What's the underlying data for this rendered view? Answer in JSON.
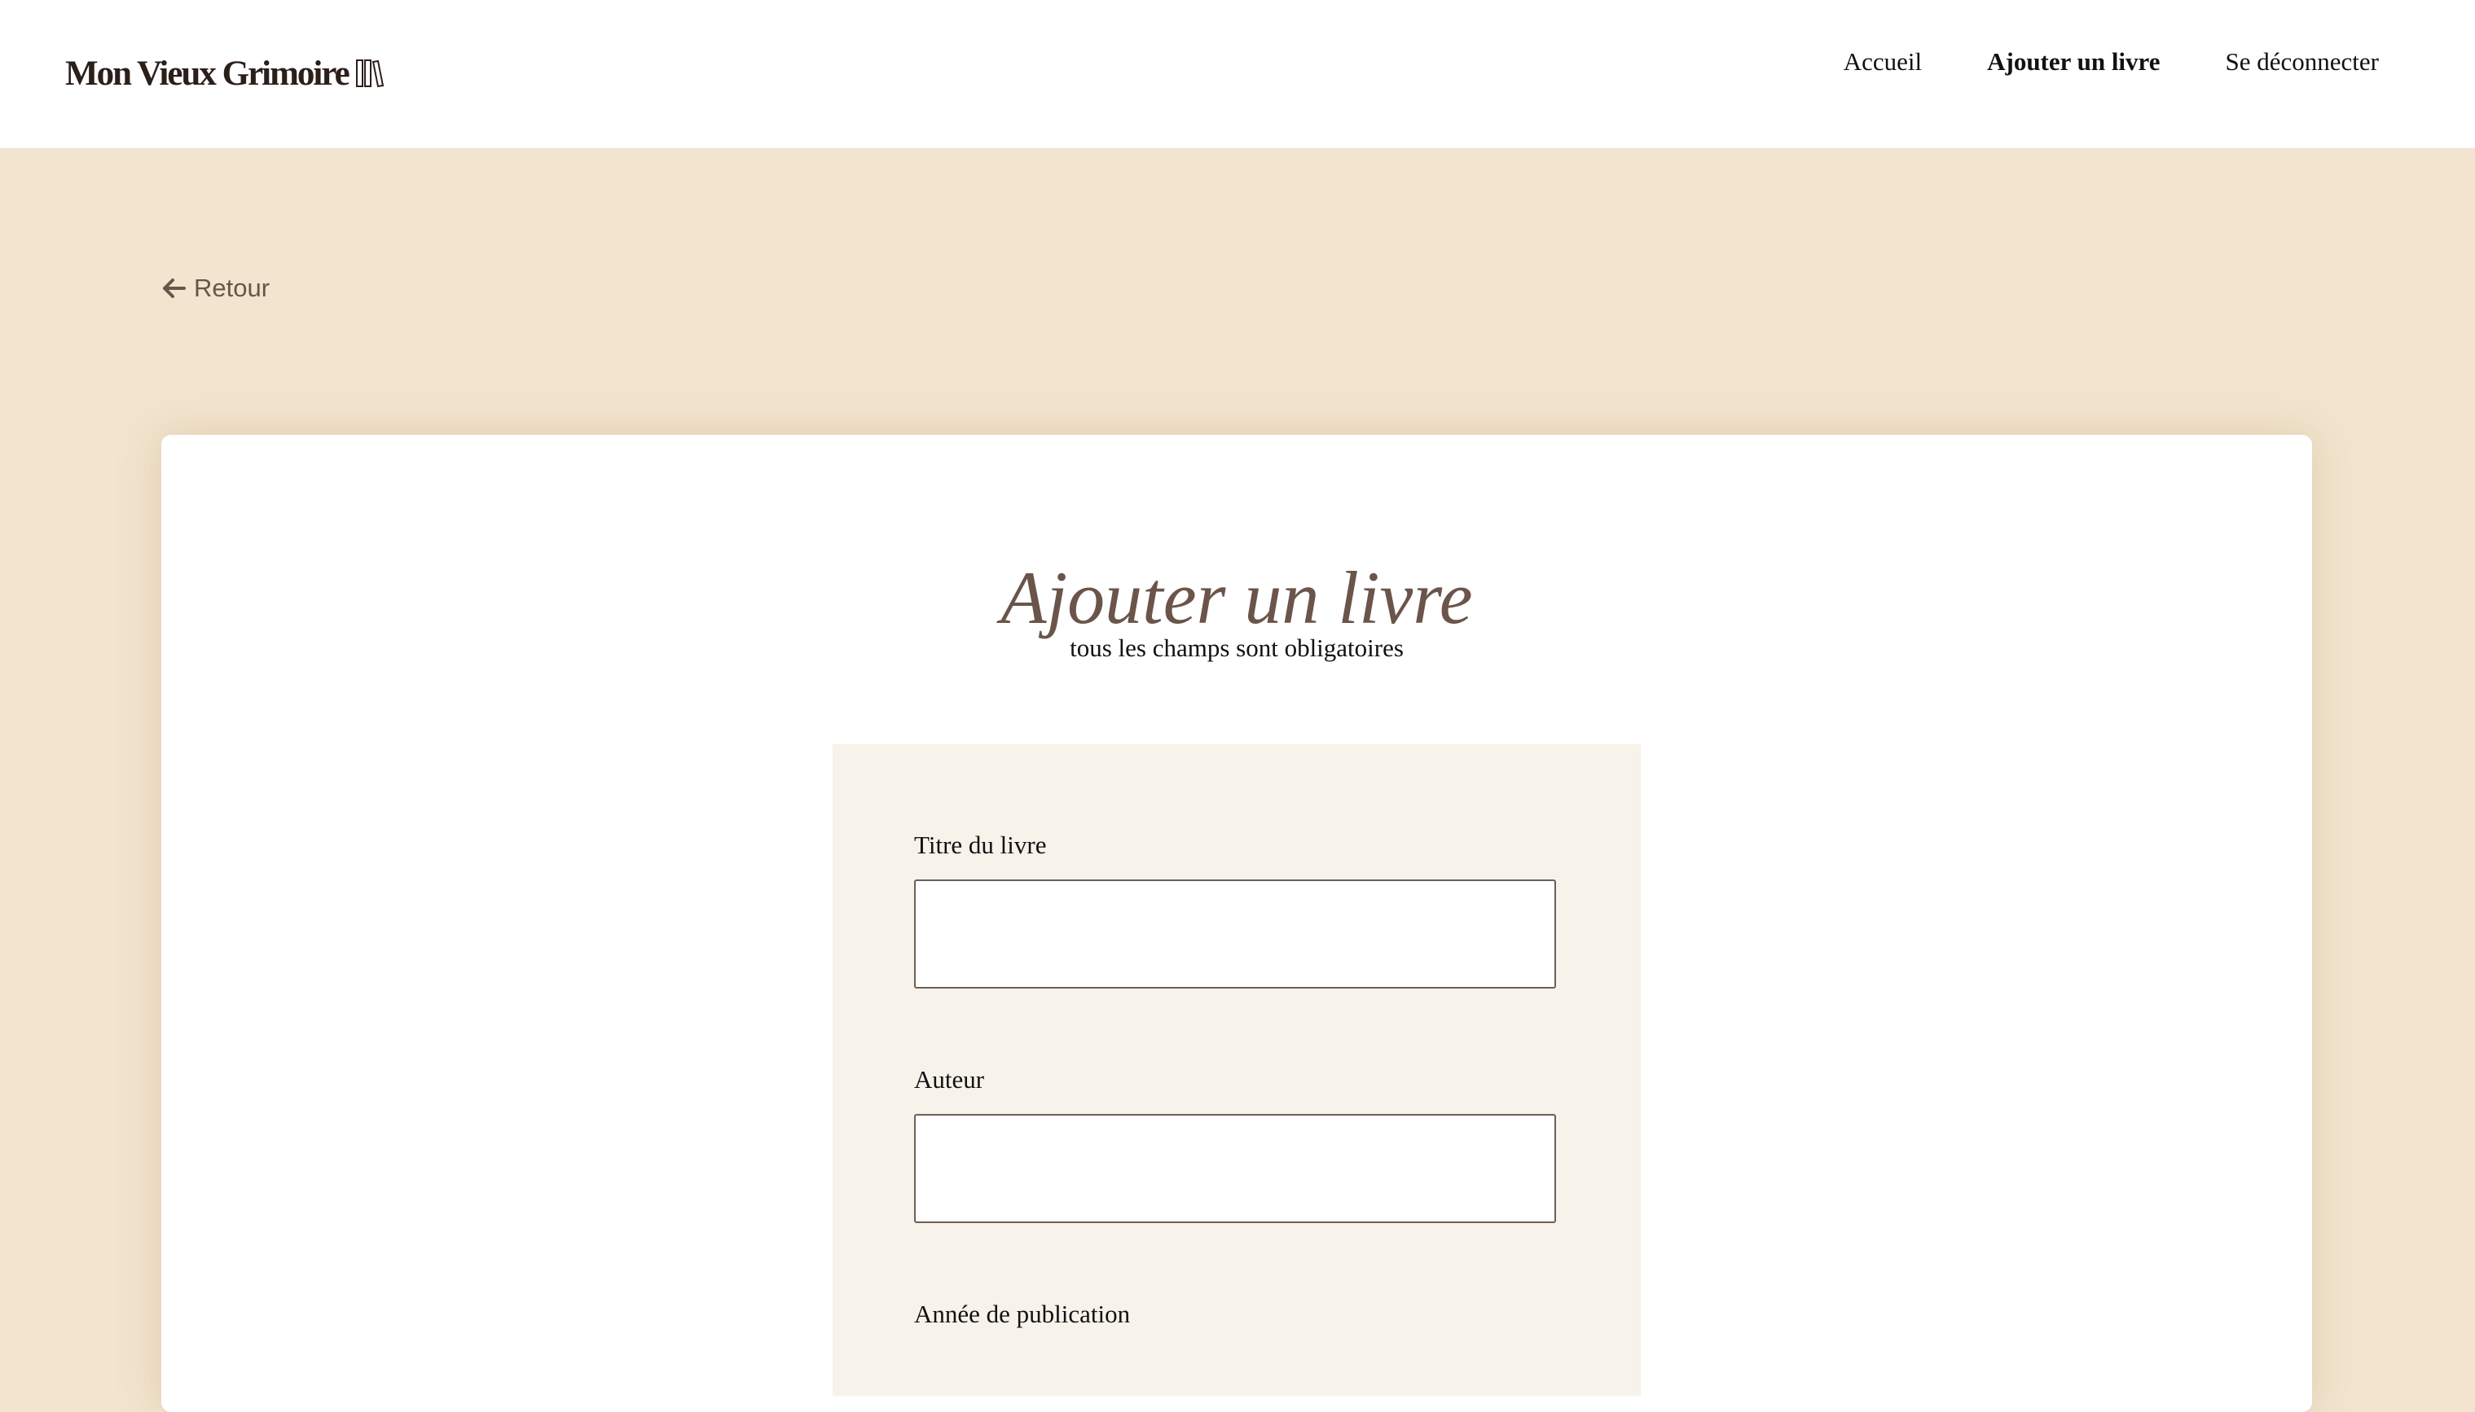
{
  "header": {
    "logo_text": "Mon Vieux Grimoire",
    "logo_icon": "books-icon",
    "nav": [
      {
        "label": "Accueil",
        "active": false
      },
      {
        "label": "Ajouter un livre",
        "active": true
      },
      {
        "label": "Se déconnecter",
        "active": false
      }
    ]
  },
  "back": {
    "label": "Retour",
    "icon": "arrow-left-icon"
  },
  "form": {
    "title": "Ajouter un livre",
    "subtitle": "tous les champs sont obligatoires",
    "fields": [
      {
        "label": "Titre du livre",
        "value": "",
        "placeholder": ""
      },
      {
        "label": "Auteur",
        "value": "",
        "placeholder": ""
      },
      {
        "label": "Année de publication"
      }
    ]
  },
  "colors": {
    "page_background": "#f2e4cf",
    "accent_brown": "#6b5449",
    "panel_background": "#f7f2ea"
  }
}
